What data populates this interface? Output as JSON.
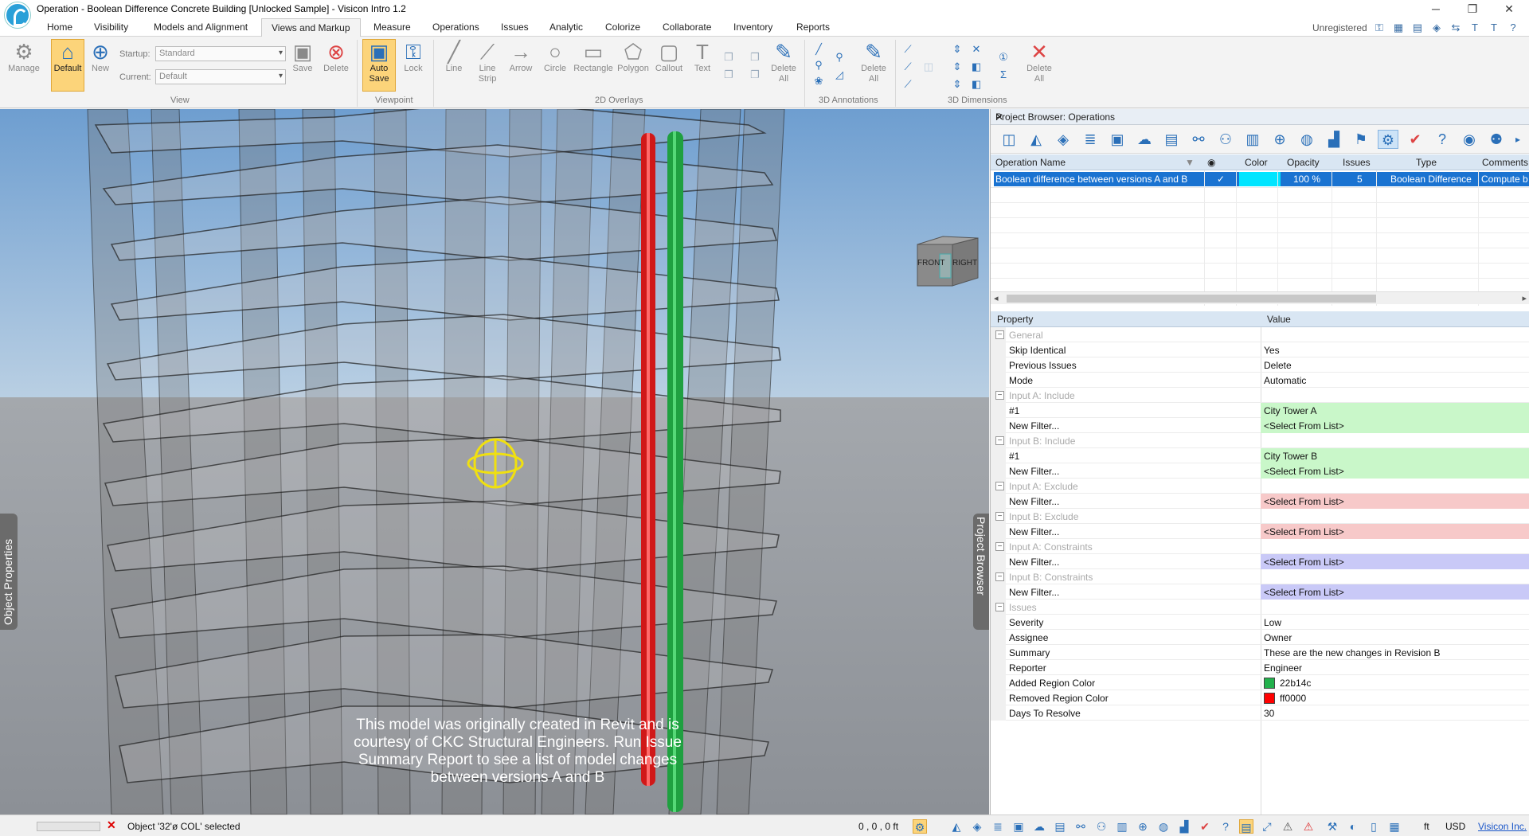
{
  "window": {
    "title": "Operation - Boolean Difference Concrete Building [Unlocked Sample] - Visicon Intro 1.2",
    "minimize": "─",
    "restore": "❐",
    "close": "✕"
  },
  "menu": {
    "tabs": [
      "Home",
      "Visibility",
      "Models and Alignment",
      "Views and Markup",
      "Measure",
      "Operations",
      "Issues",
      "Analytic",
      "Colorize",
      "Collaborate",
      "Inventory",
      "Reports"
    ],
    "active_tab": "Views and Markup",
    "unregistered": "Unregistered"
  },
  "ribbon": {
    "view_group": {
      "label": "View",
      "manage": "Manage",
      "default": "Default",
      "new": "New",
      "startup_label": "Startup:",
      "startup_value": "Standard",
      "current_label": "Current:",
      "current_value": "Default",
      "save": "Save",
      "delete": "Delete"
    },
    "viewpoint_group": {
      "label": "Viewpoint",
      "auto_save": "Auto Save",
      "lock": "Lock"
    },
    "overlays_group": {
      "label": "2D Overlays",
      "line": "Line",
      "line_strip": "Line Strip",
      "arrow": "Arrow",
      "circle": "Circle",
      "rectangle": "Rectangle",
      "polygon": "Polygon",
      "callout": "Callout",
      "text": "Text",
      "delete_all": "Delete All"
    },
    "annotations_group": {
      "label": "3D Annotations",
      "delete_all": "Delete All"
    },
    "dimensions_group": {
      "label": "3D Dimensions",
      "delete_all": "Delete All"
    }
  },
  "viewport": {
    "courtesy_text": "This model was originally created in Revit and is courtesy of CKC Structural Engineers. Run Issue Summary Report to see a list of model changes between versions A and B",
    "object_properties_tab": "Object Properties",
    "project_browser_tab": "Project Browser",
    "view_cube": {
      "front": "FRONT",
      "right": "RIGHT"
    }
  },
  "panel": {
    "title": "Project Browser: Operations",
    "close": "✕",
    "grid": {
      "columns": [
        "Operation Name",
        "",
        "Color",
        "Opacity",
        "Issues",
        "Type",
        "Comments"
      ],
      "rows": [
        {
          "name": "Boolean difference between versions A and B",
          "check": "✓",
          "color": "#00e5ff",
          "opacity": "100 %",
          "issues": "5",
          "type": "Boolean Difference",
          "comments": "Compute b"
        }
      ]
    },
    "properties": {
      "header_property": "Property",
      "header_value": "Value",
      "rows": [
        {
          "kind": "cat",
          "name": "General"
        },
        {
          "name": "Skip Identical",
          "value": "Yes"
        },
        {
          "name": "Previous Issues",
          "value": "Delete"
        },
        {
          "name": "Mode",
          "value": "Automatic"
        },
        {
          "kind": "cat",
          "name": "Input A: Include"
        },
        {
          "name": "#1",
          "value": "City Tower A",
          "tint": "green"
        },
        {
          "name": "New Filter...",
          "value": "<Select From List>",
          "tint": "green"
        },
        {
          "kind": "cat",
          "name": "Input B: Include"
        },
        {
          "name": "#1",
          "value": "City Tower B",
          "tint": "green"
        },
        {
          "name": "New Filter...",
          "value": "<Select From List>",
          "tint": "green"
        },
        {
          "kind": "cat",
          "name": "Input A: Exclude"
        },
        {
          "name": "New Filter...",
          "value": "<Select From List>",
          "tint": "red"
        },
        {
          "kind": "cat",
          "name": "Input B: Exclude"
        },
        {
          "name": "New Filter...",
          "value": "<Select From List>",
          "tint": "red"
        },
        {
          "kind": "cat",
          "name": "Input A: Constraints"
        },
        {
          "name": "New Filter...",
          "value": "<Select From List>",
          "tint": "blue"
        },
        {
          "kind": "cat",
          "name": "Input B: Constraints"
        },
        {
          "name": "New Filter...",
          "value": "<Select From List>",
          "tint": "blue"
        },
        {
          "kind": "cat",
          "name": "Issues"
        },
        {
          "name": "Severity",
          "value": "Low"
        },
        {
          "name": "Assignee",
          "value": "Owner"
        },
        {
          "name": "Summary",
          "value": "These are the new changes in Revision B"
        },
        {
          "name": "Reporter",
          "value": "Engineer"
        },
        {
          "name": "Added Region Color",
          "value": "22b14c",
          "swatch": "#22b14c"
        },
        {
          "name": "Removed Region Color",
          "value": "ff0000",
          "swatch": "#ff0000"
        },
        {
          "name": "Days To Resolve",
          "value": "30"
        }
      ]
    }
  },
  "status": {
    "selection_text": "Object '32'ø COL' selected",
    "coords": "0 , 0 , 0 ft",
    "unit": "ft",
    "currency": "USD",
    "company_link": "Visicon Inc."
  },
  "colors": {
    "accent": "#1a73d1",
    "added": "#22b14c",
    "removed": "#ff0000",
    "highlight": "#fcd47a"
  }
}
